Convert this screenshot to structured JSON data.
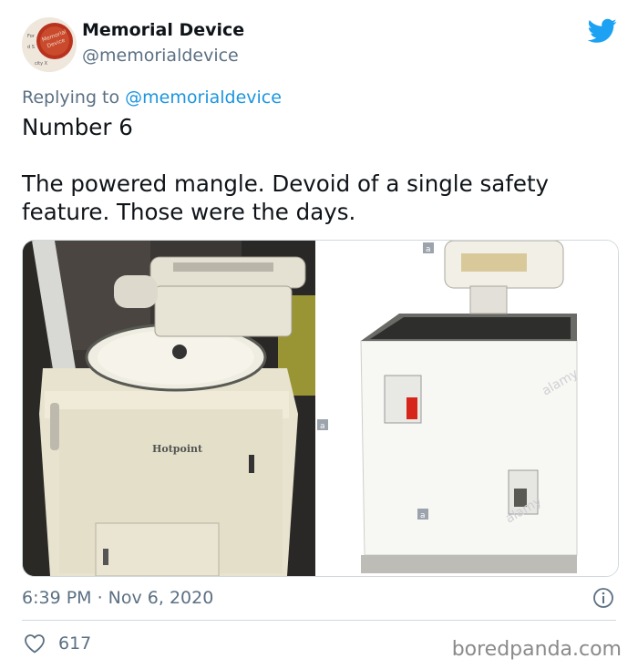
{
  "author": {
    "name": "Memorial Device",
    "handle": "@memorialdevice",
    "avatar_icon": "memorial-device-badge-avatar"
  },
  "reply": {
    "prefix": "Replying to",
    "mention": "@memorialdevice"
  },
  "tweet": {
    "line1": "Number 6",
    "line2": "The powered mangle. Devoid of a single safety feature. Those were the days."
  },
  "media": {
    "left_brand": "Hotpoint",
    "right_watermark": "alamy",
    "right_mark": "a"
  },
  "meta": {
    "timestamp": "6:39 PM · Nov 6, 2020",
    "likes": "617"
  },
  "watermark": "boredpanda.com",
  "colors": {
    "twitter_blue": "#1b95e0",
    "muted_text": "#5b7083",
    "divider": "#cfd9de"
  },
  "icons": [
    "twitter-bird-icon",
    "info-icon",
    "heart-icon"
  ]
}
